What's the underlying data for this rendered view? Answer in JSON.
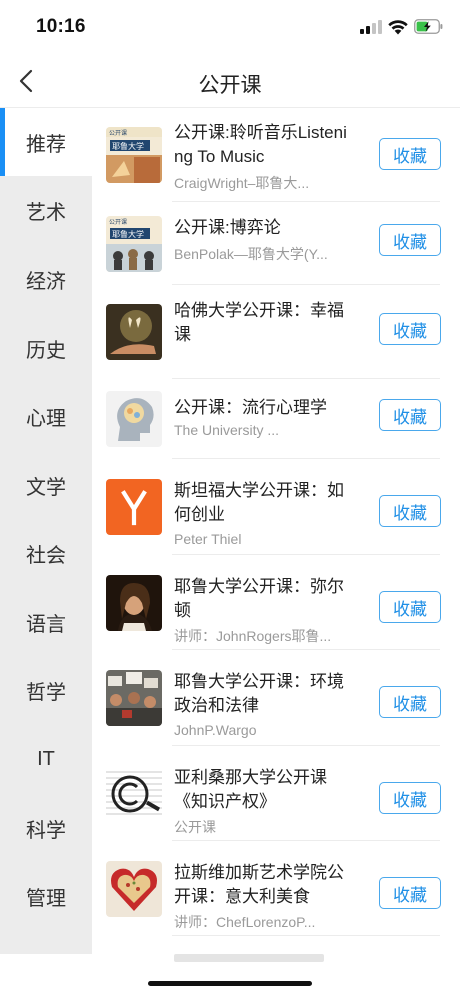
{
  "status_bar": {
    "time": "10:16"
  },
  "nav": {
    "title": "公开课",
    "back_icon": "chevron-left-icon"
  },
  "sidebar": {
    "active_index": 0,
    "accent_color": "#1a8ff5",
    "items": [
      "推荐",
      "艺术",
      "经济",
      "历史",
      "心理",
      "文学",
      "社会",
      "语言",
      "哲学",
      "IT",
      "科学",
      "管理"
    ]
  },
  "courses": [
    {
      "title": "公开课:聆听音乐Listening To Music",
      "subtitle": "CraigWright–耶鲁大...",
      "button": "收藏",
      "thumb": "yale-open-course-logo"
    },
    {
      "title": "公开课:博弈论",
      "subtitle": "BenPolak—耶鲁大学(Y...",
      "button": "收藏",
      "thumb": "yale-game-theory-logo"
    },
    {
      "title": "哈佛大学公开课：幸福课",
      "subtitle": "",
      "button": "收藏",
      "thumb": "butterfly-hand-photo"
    },
    {
      "title": "公开课：流行心理学",
      "subtitle": "The University ...",
      "button": "收藏",
      "thumb": "brain-head-icon"
    },
    {
      "title": "斯坦福大学公开课：如何创业",
      "subtitle": "Peter Thiel",
      "button": "收藏",
      "thumb": "y-combinator-logo"
    },
    {
      "title": "耶鲁大学公开课：弥尔顿",
      "subtitle": "讲师：JohnRogers耶鲁...",
      "button": "收藏",
      "thumb": "milton-portrait"
    },
    {
      "title": "耶鲁大学公开课：环境政治和法律",
      "subtitle": "JohnP.Wargo",
      "button": "收藏",
      "thumb": "protest-crowd-photo"
    },
    {
      "title": "亚利桑那大学公开课《知识产权》",
      "subtitle": "公开课",
      "button": "收藏",
      "thumb": "copyright-symbol"
    },
    {
      "title": "拉斯维加斯艺术学院公开课：意大利美食",
      "subtitle": "讲师：ChefLorenzoP...",
      "button": "收藏",
      "thumb": "spaghetti-heart-photo"
    }
  ]
}
